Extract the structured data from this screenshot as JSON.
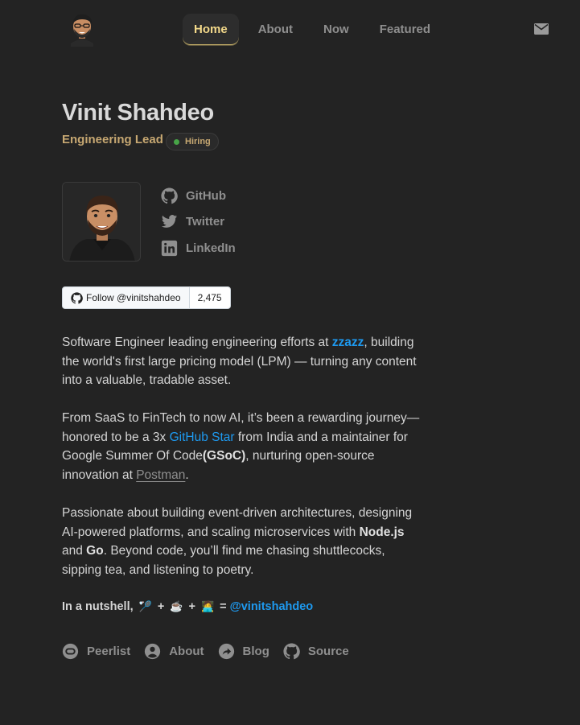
{
  "nav": {
    "items": [
      {
        "label": "Home",
        "active": true
      },
      {
        "label": "About",
        "active": false
      },
      {
        "label": "Now",
        "active": false
      },
      {
        "label": "Featured",
        "active": false
      }
    ],
    "mail_icon": "mail-icon"
  },
  "profile": {
    "name": "Vinit Shahdeo",
    "role": "Engineering Lead",
    "badge": "Hiring",
    "badge_color": "#47a447"
  },
  "socials": [
    {
      "label": "GitHub",
      "icon": "github-icon"
    },
    {
      "label": "Twitter",
      "icon": "twitter-icon"
    },
    {
      "label": "LinkedIn",
      "icon": "linkedin-icon"
    }
  ],
  "github_follow": {
    "label": "Follow @vinitshahdeo",
    "count": "2,475"
  },
  "bio": {
    "p1": {
      "before": "Software Engineer leading engineering efforts at ",
      "link": "zzazz",
      "after": ", building the world's first large pricing model (LPM) — turning any content into a valuable, tradable asset."
    },
    "p2": {
      "before": "From SaaS to FinTech to now AI, it’s been a rewarding journey—honored to be a 3x ",
      "link": "GitHub Star",
      "middle": " from India and a maintainer for Google Summer Of Code",
      "strong": "(GSoC)",
      "middle2": ", nurturing open-source innovation at ",
      "link2": "Postman",
      "after": "."
    },
    "p3": {
      "before": "Passionate about building event-driven architectures, designing AI-powered platforms, and scaling microservices with ",
      "strong1": "Node.js",
      "and": " and ",
      "strong2": "Go",
      "after": ". Beyond code, you’ll find me chasing shuttlecocks, sipping tea, and listening to poetry."
    }
  },
  "nutshell": {
    "label": "In a nutshell,",
    "emoji1": "🏸",
    "plus": "+",
    "emoji2": "☕",
    "emoji3": "🧑‍💻",
    "equals": "=",
    "handle": "@vinitshahdeo"
  },
  "footer": [
    {
      "label": "Peerlist",
      "icon": "peerlist-icon"
    },
    {
      "label": "About",
      "icon": "user-icon"
    },
    {
      "label": "Blog",
      "icon": "share-arrow-icon"
    },
    {
      "label": "Source",
      "icon": "github-icon"
    }
  ],
  "colors": {
    "background": "#232323",
    "accent": "#f3d98a",
    "role": "#c7a872",
    "link": "#1e9af0"
  }
}
